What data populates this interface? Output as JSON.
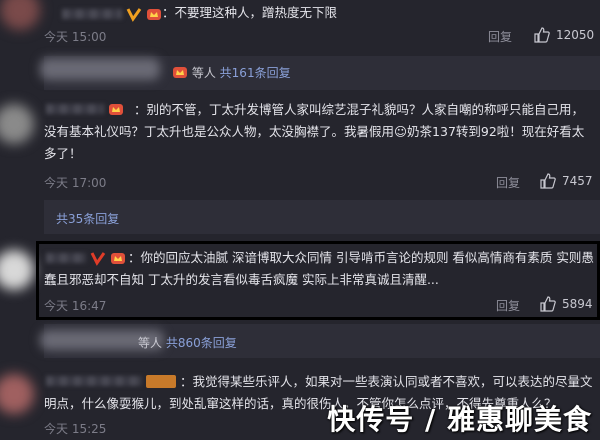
{
  "comments": [
    {
      "text": "：不要理这种人，蹭热度无下限",
      "time": "今天 15:00",
      "reply": "回复",
      "likes": "12050"
    },
    {
      "text": "：别的不管，丁太升发博管人家叫综艺混子礼貌吗？人家自嘲的称呼只能自己用，没有基本礼仪吗？丁太升也是公众人物，太没胸襟了。我暑假用☺奶茶137转到92啦！现在好看太多了！",
      "time": "今天 17:00",
      "reply": "回复",
      "likes": "7457",
      "sub_link": "共35条回复"
    },
    {
      "text": "：你的回应太油腻 深谙博取大众同情 引导啃币言论的规则 看似高情商有素质 实则愚蠢且邪恶却不自知 丁太升的发言看似毒舌疯魔 实际上非常真诚且清醒...",
      "time": "今天 16:47",
      "reply": "回复",
      "likes": "5894"
    },
    {
      "text": "：我觉得某些乐评人，如果对一些表演认同或者不喜欢，可以表达的尽量文明点，什么像耍猴儿，到处乱窜这样的话，真的很伤人，不管你怎么点评，不得先尊重人么？",
      "time": "今天 15:25"
    }
  ],
  "sub_replies": {
    "first": {
      "label": "等人",
      "count_label": "共161条回复"
    },
    "fourth": {
      "label": "等人",
      "count_label": "共860条回复"
    }
  },
  "watermark": "快传号 / 雅惠聊美食"
}
